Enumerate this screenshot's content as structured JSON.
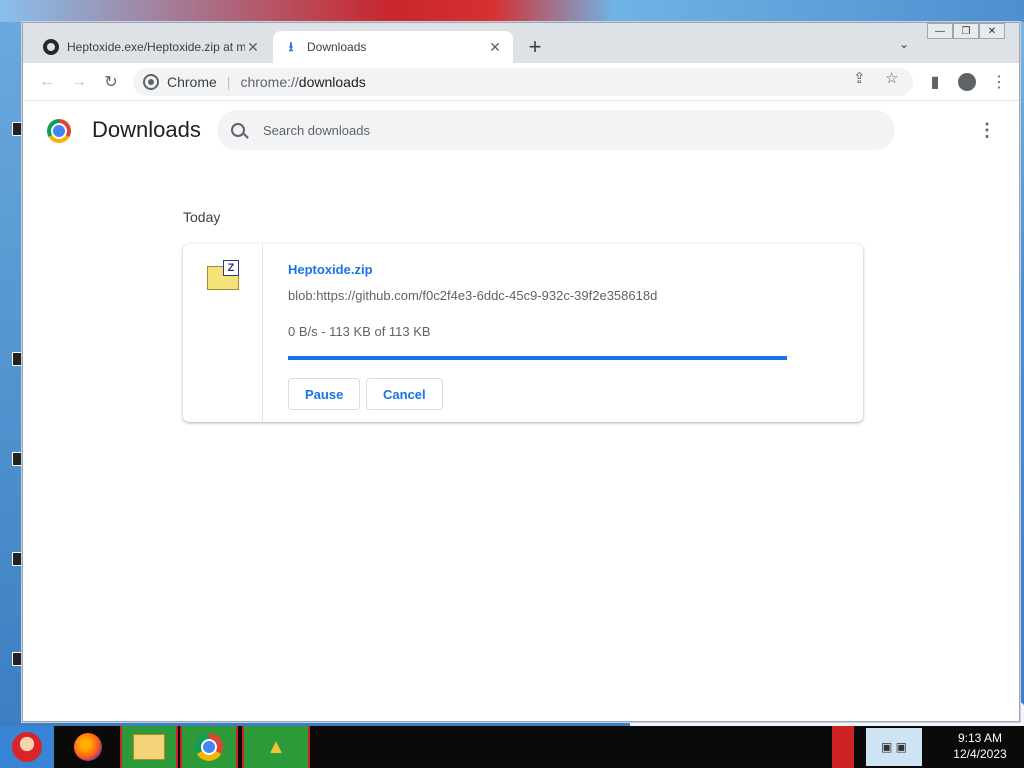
{
  "browser": {
    "tabs": [
      {
        "title": "Heptoxide.exe/Heptoxide.zip at m",
        "icon": "github-icon",
        "active": false
      },
      {
        "title": "Downloads",
        "icon": "download-icon",
        "active": true
      }
    ],
    "omnibox": {
      "chip": "Chrome",
      "url_prefix": "chrome://",
      "url_path": "downloads"
    }
  },
  "downloads_page": {
    "title": "Downloads",
    "search_placeholder": "Search downloads",
    "date_heading": "Today",
    "items": [
      {
        "file_name": "Heptoxide.zip",
        "url": "blob:https://github.com/f0c2f4e3-6ddc-45c9-932c-39f2e358618d",
        "status": "0 B/s - 113 KB of 113 KB",
        "progress_percent": 100,
        "pause_label": "Pause",
        "cancel_label": "Cancel"
      }
    ]
  },
  "taskbar": {
    "time": "9:13 AM",
    "date": "12/4/2023"
  },
  "colors": {
    "accent": "#1a73e8",
    "tabstrip": "#dee1e6",
    "taskbar": "#0a0a0a"
  }
}
